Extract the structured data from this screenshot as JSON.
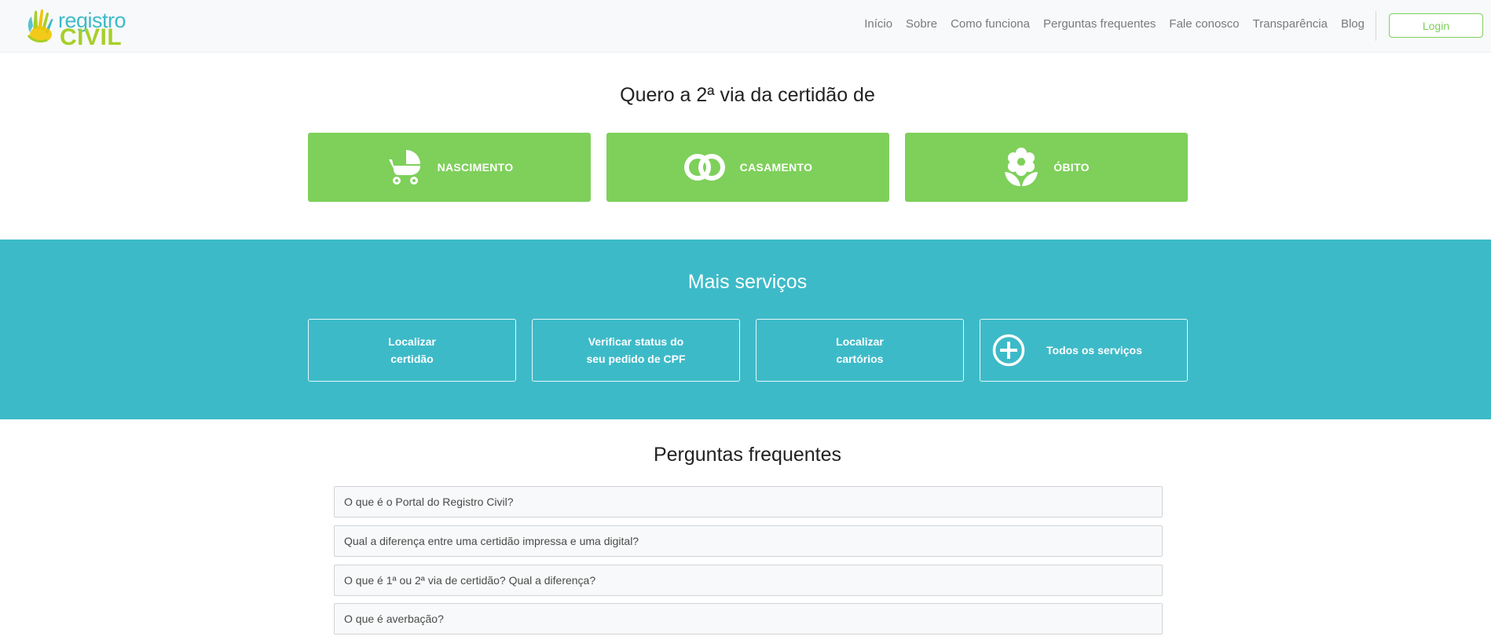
{
  "header": {
    "logo": {
      "line1": "registro",
      "line2": "CIVIL"
    },
    "nav": [
      "Início",
      "Sobre",
      "Como funciona",
      "Perguntas frequentes",
      "Fale conosco",
      "Transparência",
      "Blog"
    ],
    "login_label": "Login"
  },
  "certidao": {
    "title": "Quero a 2ª via da certidão de",
    "cards": [
      {
        "label": "NASCIMENTO",
        "icon": "baby-stroller-icon"
      },
      {
        "label": "CASAMENTO",
        "icon": "wedding-rings-icon"
      },
      {
        "label": "ÓBITO",
        "icon": "flower-icon"
      }
    ]
  },
  "servicos": {
    "title": "Mais serviços",
    "cards": [
      {
        "label": "Localizar\ncertidão"
      },
      {
        "label": "Verificar status do\nseu pedido de CPF"
      },
      {
        "label": "Localizar\ncartórios"
      },
      {
        "label": "Todos os serviços",
        "icon": "plus-circle-icon"
      }
    ]
  },
  "faq": {
    "title": "Perguntas frequentes",
    "items": [
      "O que é o Portal do Registro Civil?",
      "Qual a diferença entre uma certidão impressa e uma digital?",
      "O que é 1ª ou 2ª via de certidão? Qual a diferença?",
      "O que é averbação?"
    ]
  },
  "colors": {
    "green": "#7ed05a",
    "teal": "#3dbac8",
    "logo_yellow_green": "#a6cf2a"
  }
}
